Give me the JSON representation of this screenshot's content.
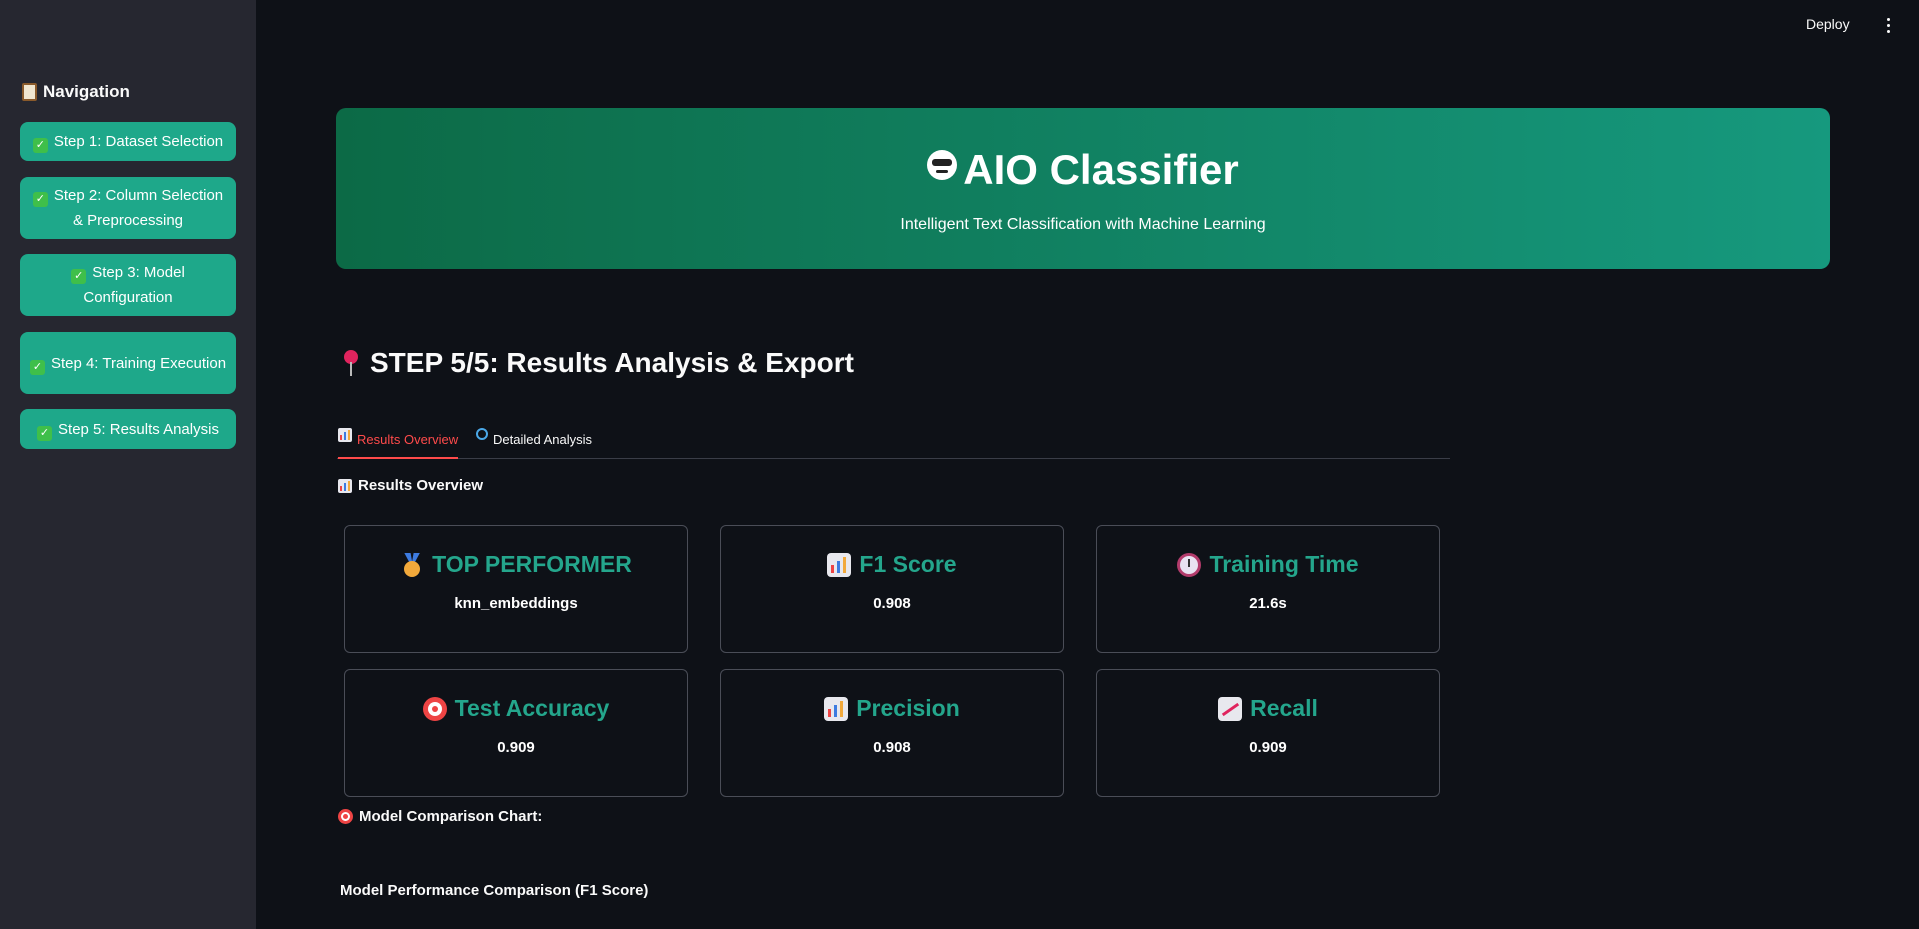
{
  "header": {
    "deploy_label": "Deploy"
  },
  "sidebar": {
    "title": "Navigation",
    "items": [
      {
        "label": "Step 1: Dataset Selection"
      },
      {
        "label": "Step 2: Column Selection & Preprocessing"
      },
      {
        "label": "Step 3: Model Configuration"
      },
      {
        "label": "Step 4: Training Execution"
      },
      {
        "label": "Step 5: Results Analysis"
      }
    ]
  },
  "banner": {
    "title": "AIO Classifier",
    "subtitle": "Intelligent Text Classification with Machine Learning"
  },
  "main": {
    "step_heading": "STEP 5/5: Results Analysis & Export",
    "tabs": [
      {
        "label": "Results Overview",
        "active": true
      },
      {
        "label": "Detailed Analysis",
        "active": false
      }
    ],
    "section_label": "Results Overview",
    "cards": [
      {
        "title": "TOP PERFORMER",
        "value": "knn_embeddings",
        "icon": "medal-icon"
      },
      {
        "title": "F1 Score",
        "value": "0.908",
        "icon": "bar-chart-icon"
      },
      {
        "title": "Training Time",
        "value": "21.6s",
        "icon": "alarm-clock-icon"
      },
      {
        "title": "Test Accuracy",
        "value": "0.909",
        "icon": "target-icon"
      },
      {
        "title": "Precision",
        "value": "0.908",
        "icon": "bar-chart-icon"
      },
      {
        "title": "Recall",
        "value": "0.909",
        "icon": "trend-up-icon"
      }
    ],
    "comparison_label": "Model Comparison Chart:",
    "chart_title": "Model Performance Comparison (F1 Score)"
  },
  "colors": {
    "accent": "#1ea88a",
    "card_title": "#24a68c",
    "active_tab": "#ff4b4b",
    "background": "#0e1117",
    "sidebar": "#262730"
  }
}
